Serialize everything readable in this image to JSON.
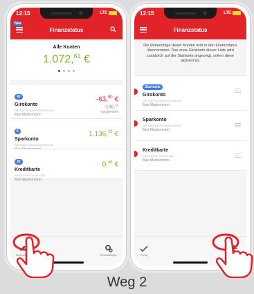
{
  "left": {
    "time": "12:15",
    "network": "LTE",
    "new_badge": "Neu",
    "title": "Finanzstatus",
    "total_label": "Alle Konten",
    "total_main": "1.072,",
    "total_cents": "61",
    "total_currency": "€",
    "accounts": [
      {
        "badge": "40",
        "name": "Girokonto",
        "iban": "DE75 5075 0000 0000 0000 00",
        "owner": "Max Mustermann",
        "main": "-63,",
        "cents": "90",
        "currency": "€",
        "reserved_main": "-166,",
        "reserved_cents": "62",
        "reserved_label": "vorgemerkt"
      },
      {
        "badge": "6",
        "name": "Sparkonto",
        "iban": "DE75 5075 0000 0000 0000 00",
        "owner": "Max Mustermann",
        "main": "1.136,",
        "cents": "29",
        "currency": "€"
      },
      {
        "badge": "30",
        "name": "Kreditkarte",
        "iban": "XXXX XXXX XXXX 1234",
        "owner": "Max Mustermann",
        "main": "0,",
        "cents": "46",
        "currency": "€"
      }
    ],
    "toolbar": {
      "edit": "Bearbeiten",
      "settings": "Einstellungen"
    }
  },
  "right": {
    "time": "12:15",
    "network": "LTE",
    "title": "Finanzstatus",
    "info": "Die Reihenfolge dieser Konten wird in den Finanzstatus übernommen. Das erste Girokonto dieser Liste wird zusätzlich auf der Startseite angezeigt, sofern diese aktiviert ist.",
    "start_badge": "Startseite",
    "accounts": [
      {
        "name": "Girokonto",
        "iban": "DE75 5075 0000 0000 0000 00",
        "owner": "Max Mustermann"
      },
      {
        "name": "Sparkonto",
        "iban": "DE75 5075 0000 0000 0000 00",
        "owner": "Max Mustermann"
      },
      {
        "name": "Kreditkarte",
        "iban": "XXXX XXXX XXXX 1234",
        "owner": "Max Mustermann"
      }
    ],
    "toolbar": {
      "done": "Fertig",
      "add": "Hinzufügen"
    }
  },
  "caption": "Weg 2",
  "colors": {
    "brand": "#e2232a",
    "positive": "#7cb32e",
    "badge": "#3d7bd9"
  }
}
